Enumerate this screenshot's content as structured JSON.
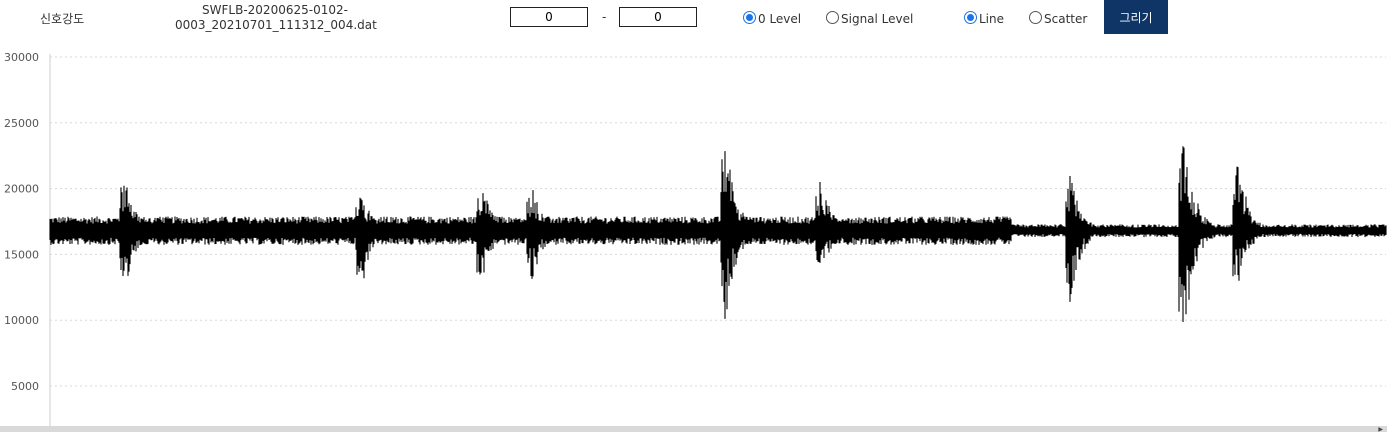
{
  "toolbar": {
    "signal_label": "신호강도",
    "file_name_line1": "SWFLB-20200625-0102-",
    "file_name_line2": "0003_20210701_111312_004.dat",
    "range_from": "0",
    "range_separator": "-",
    "range_to": "0",
    "level_options": [
      {
        "label": "0 Level",
        "selected": true
      },
      {
        "label": "Signal Level",
        "selected": false
      }
    ],
    "plot_style_options": [
      {
        "label": "Line",
        "selected": true
      },
      {
        "label": "Scatter",
        "selected": false
      }
    ],
    "draw_button_label": "그리기",
    "draw_button_color": "#0f3566",
    "radio_accent_color": "#1a73e8"
  },
  "chart_data": {
    "type": "line",
    "title": "",
    "xlabel": "",
    "ylabel": "",
    "y_ticks": [
      "30000",
      "25000",
      "20000",
      "15000",
      "10000",
      "5000"
    ],
    "ylim": [
      2500,
      30000
    ],
    "grid": "horizontal-dotted",
    "line_color": "#000000",
    "baseline": 16800,
    "noise_amplitude": 900,
    "bursts": [
      {
        "x": 0.055,
        "max": 21600,
        "min": 11500
      },
      {
        "x": 0.232,
        "max": 20600,
        "min": 11300
      },
      {
        "x": 0.322,
        "max": 21300,
        "min": 11800
      },
      {
        "x": 0.36,
        "max": 20800,
        "min": 11900
      },
      {
        "x": 0.505,
        "max": 24700,
        "min": 8800
      },
      {
        "x": 0.576,
        "max": 21400,
        "min": 12300
      },
      {
        "x": 0.763,
        "max": 21600,
        "min": 10700
      },
      {
        "x": 0.848,
        "max": 25500,
        "min": 7200
      },
      {
        "x": 0.888,
        "max": 23300,
        "min": 11600
      }
    ]
  }
}
